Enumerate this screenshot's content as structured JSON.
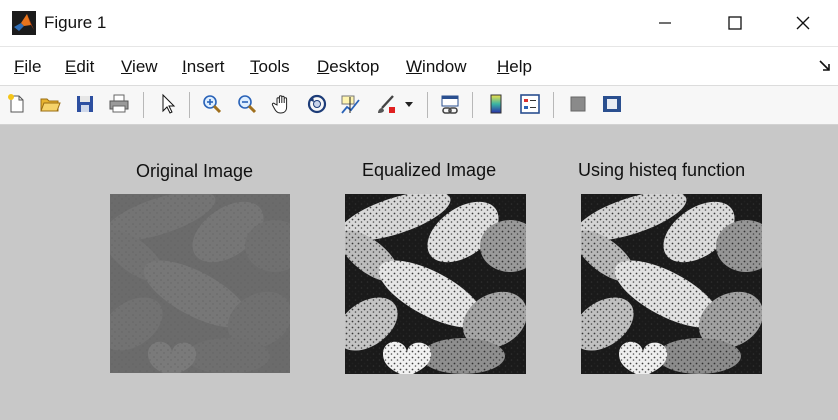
{
  "window": {
    "title": "Figure 1"
  },
  "menu": [
    {
      "label_first": "F",
      "label_rest": "ile"
    },
    {
      "label_first": "E",
      "label_rest": "dit"
    },
    {
      "label_first": "V",
      "label_rest": "iew"
    },
    {
      "label_first": "I",
      "label_rest": "nsert"
    },
    {
      "label_first": "T",
      "label_rest": "ools"
    },
    {
      "label_first": "D",
      "label_rest": "esktop"
    },
    {
      "label_first": "W",
      "label_rest": "indow"
    },
    {
      "label_first": "H",
      "label_rest": "elp"
    }
  ],
  "toolbar": {
    "icons": [
      "new-figure-icon",
      "open-file-icon",
      "save-icon",
      "print-icon",
      "edit-plot-arrow-icon",
      "zoom-in-icon",
      "zoom-out-icon",
      "pan-hand-icon",
      "rotate-3d-icon",
      "data-cursor-icon",
      "brush-icon",
      "brush-dropdown-icon",
      "link-plot-icon",
      "colorbar-icon",
      "legend-icon",
      "hide-plot-tools-icon",
      "show-plot-tools-icon"
    ]
  },
  "axes": [
    {
      "title": "Original Image",
      "style": "low-contrast"
    },
    {
      "title": "Equalized Image",
      "style": "equalized"
    },
    {
      "title": "Using histeq function",
      "style": "equalized"
    }
  ],
  "colors": {
    "figure_bg": "#c8c8c8",
    "menubar_bg": "#ffffff",
    "toolbar_bg": "#f7f7f7",
    "brush_red": "#e02020"
  }
}
